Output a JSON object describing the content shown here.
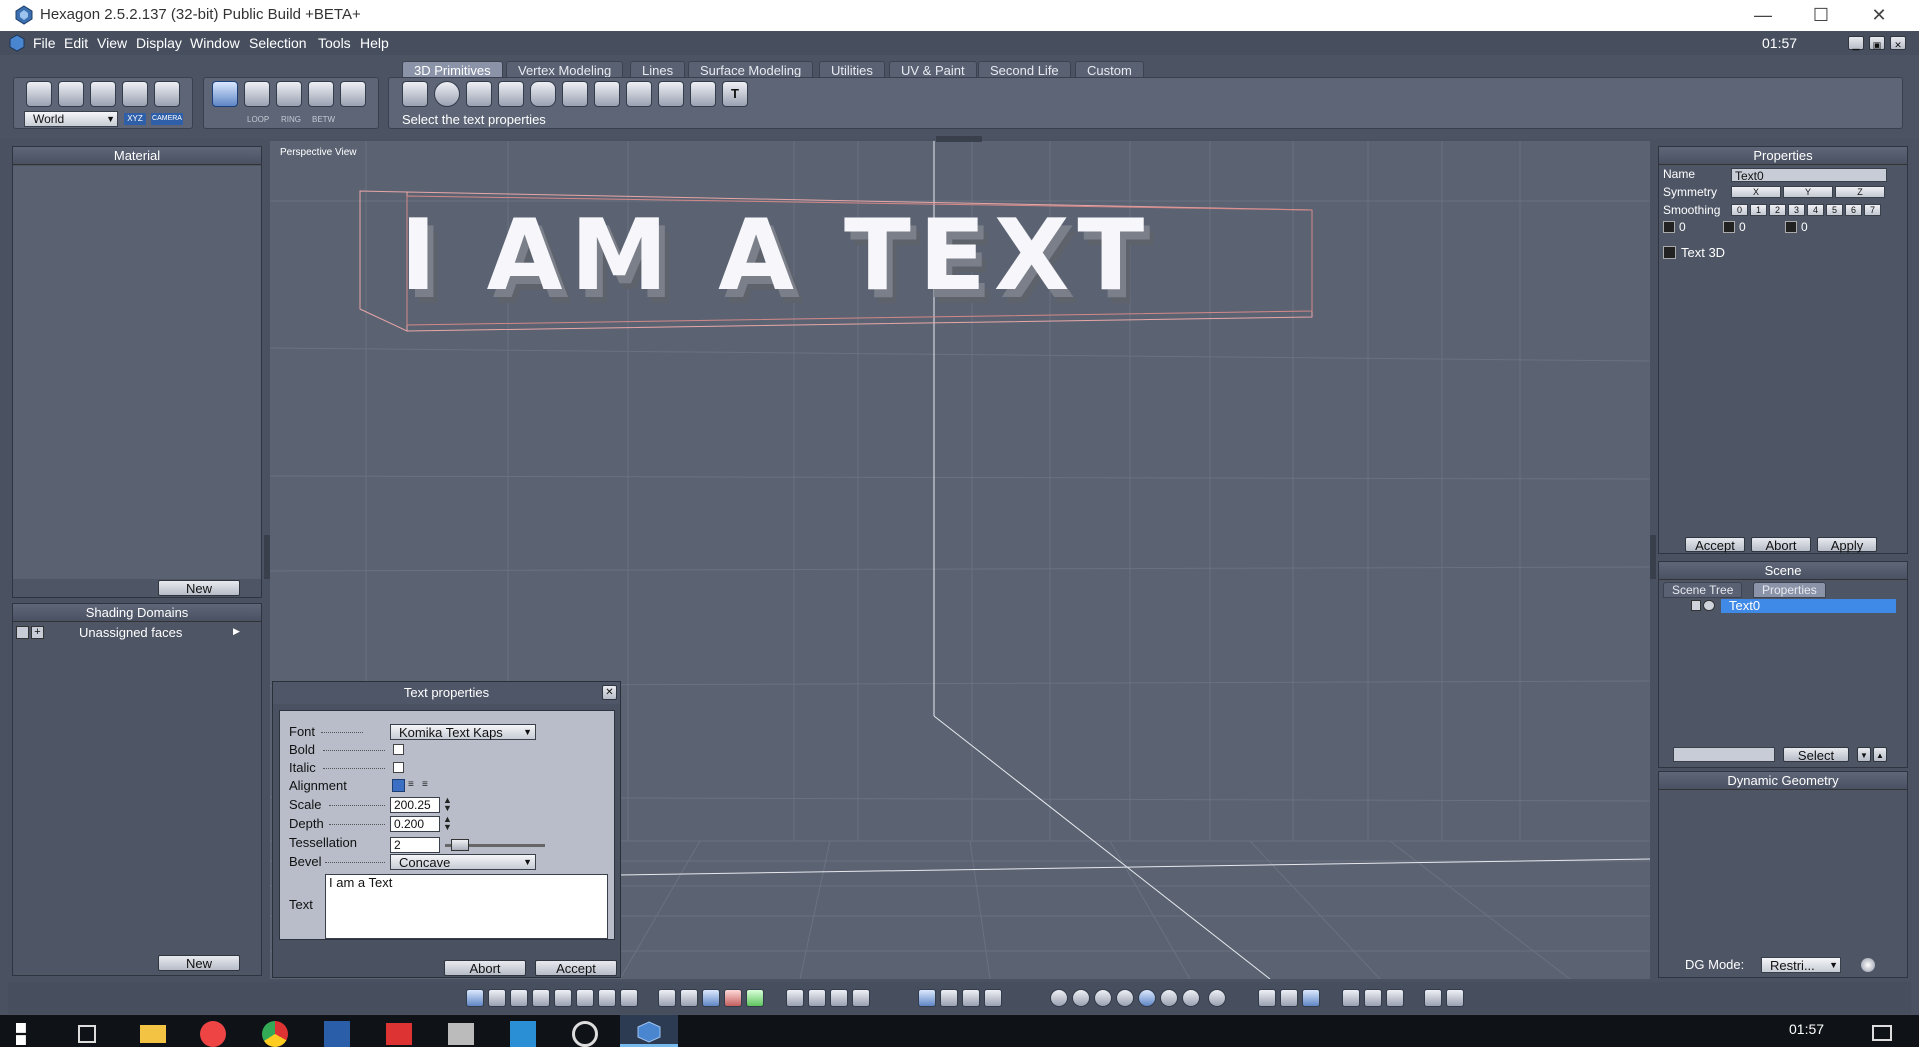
{
  "window": {
    "title": "Hexagon 2.5.2.137 (32-bit)  Public Build +BETA+",
    "minimize": "—",
    "maximize": "☐",
    "close": "✕"
  },
  "menu": {
    "items": [
      "File",
      "Edit",
      "View",
      "Display",
      "Window",
      "Selection",
      "Tools",
      "Help"
    ],
    "clock": "01:57"
  },
  "toolbar": {
    "coord_mode": "World",
    "xyz_label": "XYZ",
    "camera_label": "CAMERA",
    "loop_label": "LOOP",
    "ring_label": "RING",
    "betw_label": "BETW",
    "tabs": [
      "3D Primitives",
      "Vertex Modeling",
      "Lines",
      "Surface Modeling",
      "Utilities",
      "UV & Paint",
      "Second Life",
      "Custom"
    ],
    "active_tab": "3D Primitives",
    "status": "Select the text properties"
  },
  "material_panel": {
    "title": "Material",
    "new_button": "New"
  },
  "shading_panel": {
    "title": "Shading Domains",
    "item": "Unassigned faces",
    "new_button": "New"
  },
  "viewport": {
    "label": "Perspective View",
    "text3d": "I AM A TEXT"
  },
  "text_dialog": {
    "title": "Text properties",
    "font_label": "Font",
    "font_value": "Komika Text Kaps",
    "bold_label": "Bold",
    "italic_label": "Italic",
    "alignment_label": "Alignment",
    "scale_label": "Scale",
    "scale_value": "200.25",
    "depth_label": "Depth",
    "depth_value": "0.200",
    "tess_label": "Tessellation",
    "tess_value": "2",
    "bevel_label": "Bevel",
    "bevel_value": "Concave",
    "text_label": "Text",
    "text_value": "I am a Text",
    "abort": "Abort",
    "accept": "Accept"
  },
  "properties_panel": {
    "title": "Properties",
    "name_label": "Name",
    "name_value": "Text0",
    "symmetry_label": "Symmetry",
    "sym_axes": [
      "X",
      "Y",
      "Z"
    ],
    "smoothing_label": "Smoothing",
    "smoothing_levels": [
      "0",
      "1",
      "2",
      "3",
      "4",
      "5",
      "6",
      "7"
    ],
    "counts": [
      "0",
      "0",
      "0"
    ],
    "item": "Text 3D",
    "accept": "Accept",
    "abort": "Abort",
    "apply": "Apply"
  },
  "scene_panel": {
    "title": "Scene",
    "tabs": [
      "Scene Tree",
      "Properties"
    ],
    "item": "Text0",
    "select_button": "Select"
  },
  "dg_panel": {
    "title": "Dynamic Geometry",
    "mode_label": "DG Mode:",
    "mode_value": "Restri..."
  },
  "taskbar": {
    "clock": "01:57"
  }
}
